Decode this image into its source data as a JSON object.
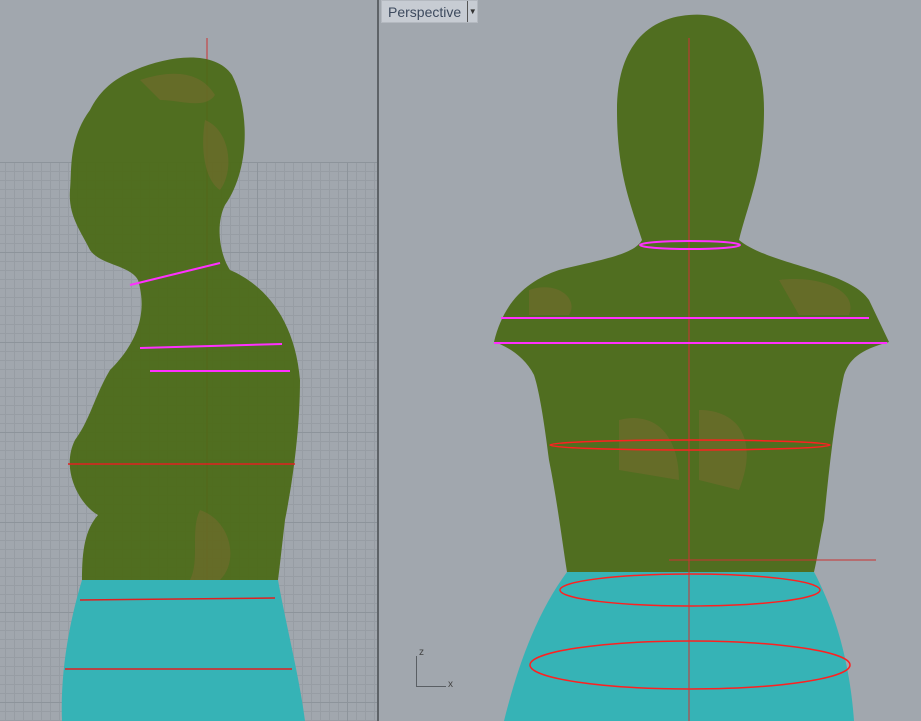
{
  "right_viewport": {
    "title": "Perspective",
    "dropdown_icon": "chevron-down-icon"
  },
  "axis_indicator": {
    "z_label": "z",
    "x_label": "x"
  },
  "colors": {
    "torso": "#4f6a1a",
    "skirt": "#35b0b3",
    "section_red": "#ff2020",
    "section_magenta": "#ff30ff",
    "background": "#a1a7ae"
  }
}
